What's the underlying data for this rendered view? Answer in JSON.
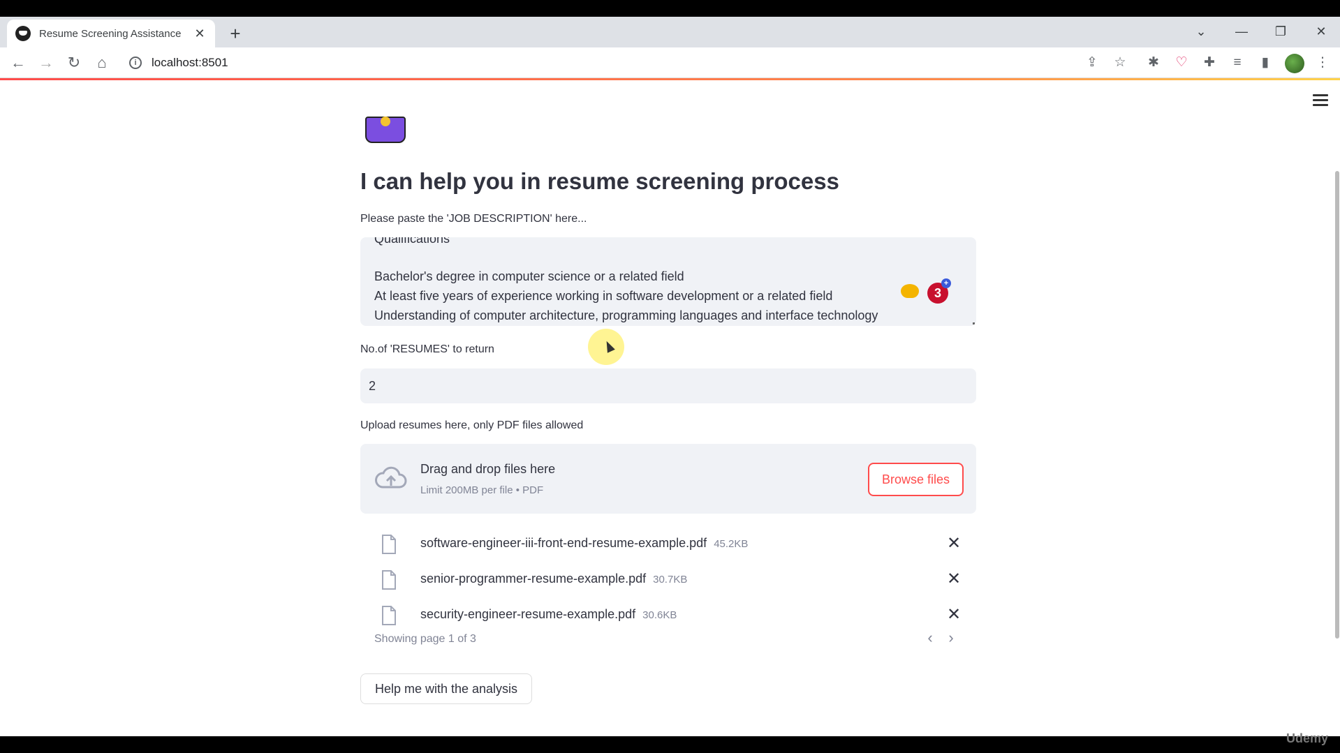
{
  "browser": {
    "tab_title": "Resume Screening Assistance",
    "tab_close": "✕",
    "new_tab": "+",
    "url": "localhost:8501"
  },
  "app": {
    "title": "I can help you in resume screening process",
    "jd_label": "Please paste the 'JOB DESCRIPTION' here...",
    "jd_lines": [
      "Qualifications",
      "",
      "Bachelor's degree in computer science or a related field",
      "At least five years of experience working in software development or a related field",
      "Understanding of computer architecture, programming languages and interface technology"
    ],
    "count_label": "No.of 'RESUMES' to return",
    "count_value": "2",
    "upload_label": "Upload resumes here, only PDF files allowed",
    "dropzone_main": "Drag and drop files here",
    "dropzone_sub": "Limit 200MB per file • PDF",
    "browse_label": "Browse files",
    "files": [
      {
        "name": "software-engineer-iii-front-end-resume-example.pdf",
        "size": "45.2KB"
      },
      {
        "name": "senior-programmer-resume-example.pdf",
        "size": "30.7KB"
      },
      {
        "name": "security-engineer-resume-example.pdf",
        "size": "30.6KB"
      }
    ],
    "remove_icon": "✕",
    "pager_text": "Showing page 1 of 3",
    "pager_prev": "‹",
    "pager_next": "›",
    "analyze_label": "Help me with the analysis",
    "ext_badge_count": "3",
    "ext_badge_plus": "+"
  },
  "watermark": "Udemy"
}
